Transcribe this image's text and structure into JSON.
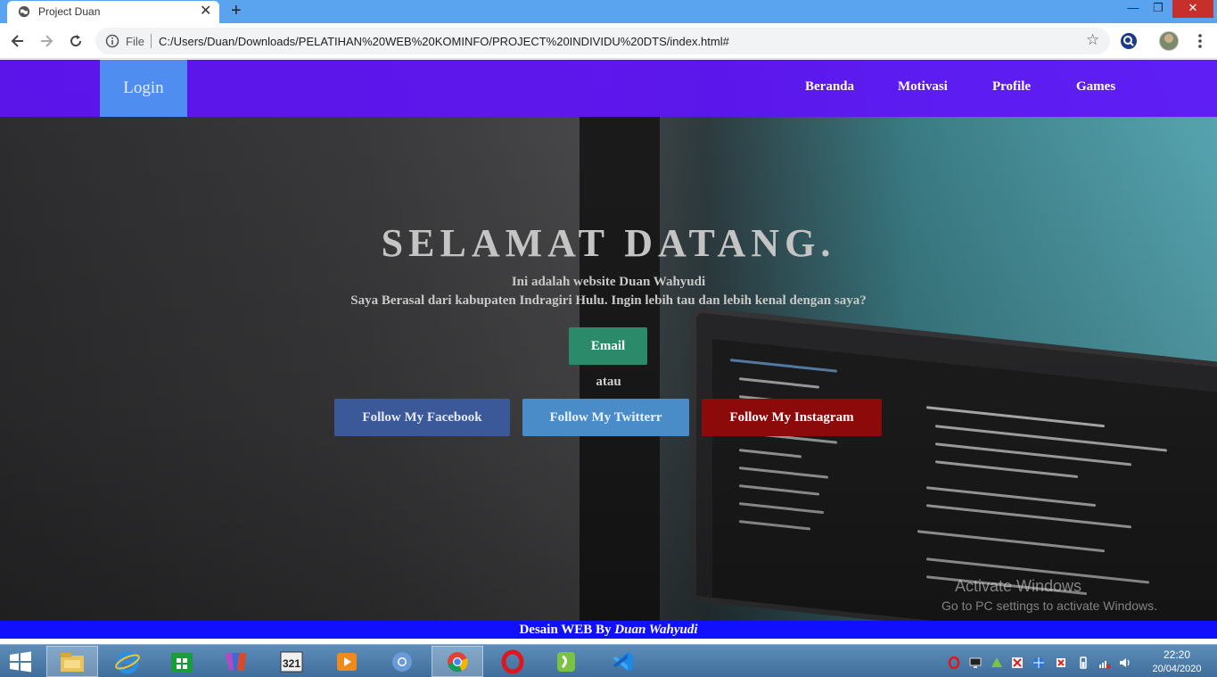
{
  "browser": {
    "tab_title": "Project Duan",
    "tab_close": "✕",
    "new_tab": "+",
    "window_min": "—",
    "window_max": "❐",
    "window_close": "✕",
    "omnibox_scheme": "File",
    "url": "C:/Users/Duan/Downloads/PELATIHAN%20WEB%20KOMINFO/PROJECT%20INDIVIDU%20DTS/index.html#",
    "star": "☆"
  },
  "navbar": {
    "login": "Login",
    "links": [
      "Beranda",
      "Motivasi",
      "Profile",
      "Games"
    ],
    "background": "#6014fa",
    "login_color": "#4f8df0"
  },
  "hero": {
    "title": "SELAMAT DATANG.",
    "subtitle1": "Ini adalah website Duan Wahyudi",
    "subtitle2": "Saya Berasal dari kabupaten Indragiri Hulu. Ingin lebih tau dan lebih kenal dengan saya?",
    "email_button": "Email",
    "separator": "atau",
    "facebook_button": "Follow My Facebook",
    "twitter_button": "Follow My Twitterr",
    "instagram_button": "Follow My Instagram"
  },
  "watermark": {
    "line1": "Activate Windows",
    "line2": "Go to PC settings to activate Windows."
  },
  "footer": {
    "prefix": "Desain WEB By ",
    "name": "Duan Wahyudi",
    "background": "#1010ff"
  },
  "taskbar": {
    "apps": [
      "file-explorer-icon",
      "internet-explorer-icon",
      "store-icon",
      "winrar-icon",
      "media-player-classic-icon",
      "media-player-icon",
      "chromium-icon",
      "chrome-icon",
      "opera-icon",
      "camtasia-icon",
      "vscode-icon"
    ],
    "clock_time": "22:20",
    "clock_date": "20/04/2020"
  }
}
